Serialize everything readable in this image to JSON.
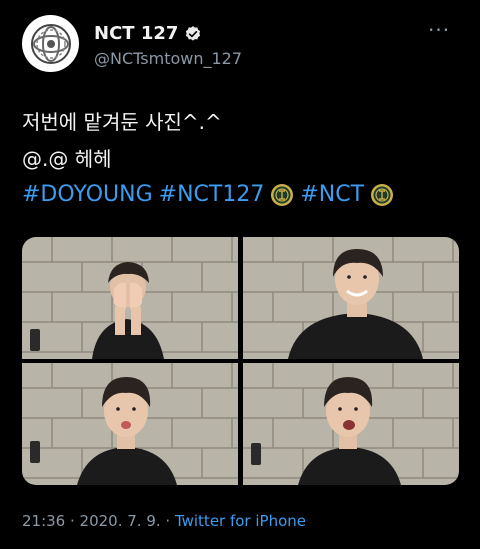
{
  "tweet": {
    "display_name": "NCT 127",
    "handle": "@NCTsmtown_127",
    "more_label": "···",
    "text_line1": "저번에 맡겨둔 사진^.^",
    "text_line2": "@.@ 헤헤",
    "hashtags": [
      "#DOYOUNG",
      "#NCT127",
      "#NCT"
    ],
    "timestamp": "21:36 · 2020. 7. 9. · ",
    "source": "Twitter for iPhone"
  },
  "colors": {
    "accent": "#3b9cf0",
    "secondary_text": "#8b98a5",
    "background": "#000000"
  },
  "icons": {
    "verified": "verified-badge-icon",
    "emblem": "nct-emblem-icon",
    "more": "more-dots-icon"
  }
}
